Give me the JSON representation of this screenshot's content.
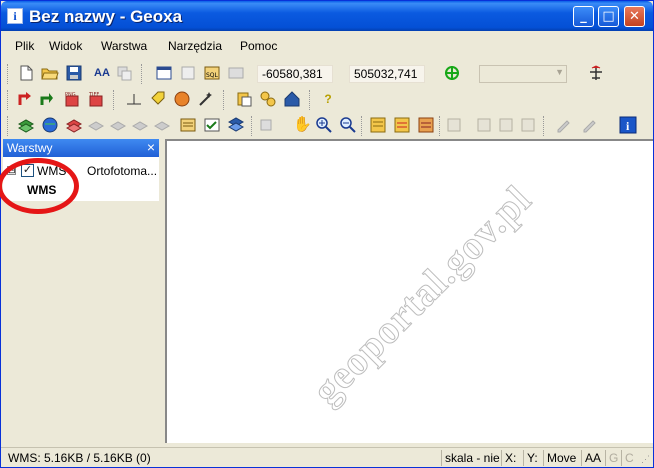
{
  "window": {
    "title": "Bez nazwy - Geoxa",
    "icon": "info-icon"
  },
  "titlebar_buttons": {
    "minimize": "_",
    "maximize": "□",
    "close": "✕"
  },
  "menu": [
    "Plik",
    "Widok",
    "Warstwa",
    "Narzędzia",
    "Pomoc"
  ],
  "toolbar": {
    "coord_x": "-60580,381",
    "coord_y": "505032,741",
    "combo_value": ""
  },
  "layers_panel": {
    "title": "Warstwy",
    "close": "×",
    "layer": {
      "expander": "⊟",
      "checked": "✓",
      "name": "WMS",
      "description": "Ortofotoma..."
    },
    "sublayer": "WMS"
  },
  "map": {
    "watermark": "geoportal.gov.pl"
  },
  "status": {
    "transfer": "WMS: 5.16KB / 5.16KB (0)",
    "scale": "skala - nie",
    "x": "X:",
    "y": "Y:",
    "mode": "Move",
    "aa": "AA",
    "g": "G",
    "c": "C"
  },
  "colors": {
    "title_bar": "#0b5ae0",
    "accent_red": "#e51616",
    "panel_head": "#2160d6"
  }
}
